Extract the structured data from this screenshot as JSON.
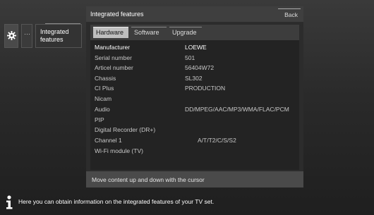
{
  "sidebar": {
    "gear_icon": "gear-icon",
    "more_label": "···",
    "integrated_label_1": "Integrated",
    "integrated_label_2": "features"
  },
  "panel": {
    "title": "Integrated features",
    "back_label": "Back",
    "tabs": [
      {
        "label": "Hardware",
        "active": true
      },
      {
        "label": "Software",
        "active": false
      },
      {
        "label": "Upgrade",
        "active": false
      }
    ],
    "rows": [
      {
        "key": "Manufacturer",
        "value": "LOEWE"
      },
      {
        "key": "Serial number",
        "value": "501"
      },
      {
        "key": "Articel number",
        "value": "56404W72"
      },
      {
        "key": "Chassis",
        "value": "SL302"
      },
      {
        "key": "CI Plus",
        "value": "PRODUCTION"
      },
      {
        "key": "Nicam",
        "value": ""
      },
      {
        "key": "Audio",
        "value": "DD/MPEG/AAC/MP3/WMA/FLAC/PCM"
      },
      {
        "key": "PIP",
        "value": ""
      },
      {
        "key": "Digital Recorder (DR+)",
        "value": ""
      },
      {
        "key": "Channel 1",
        "value": "A/T/T2/C/S/S2"
      },
      {
        "key": "Wi-Fi module (TV)",
        "value": ""
      }
    ],
    "footer": "Move content up and down with the cursor"
  },
  "info": {
    "icon": "info-icon",
    "text": "Here you can obtain information on the integrated features of your TV set."
  },
  "colors": {
    "background": "#2a2a2a",
    "active_tab": "#bfbfbf",
    "footer": "#4a4a4a"
  }
}
